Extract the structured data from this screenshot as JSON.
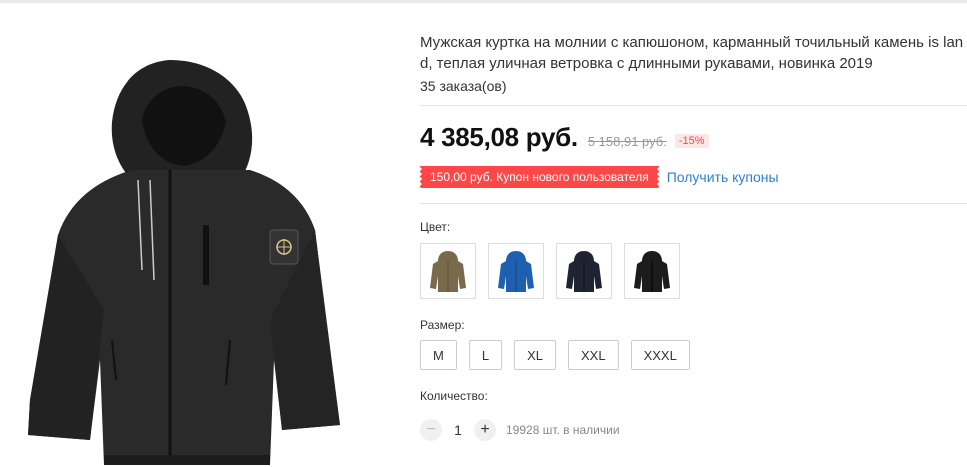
{
  "product": {
    "title": "Мужская куртка на молнии с капюшоном, карманный точильный камень is lan d, теплая уличная ветровка с длинными рукавами, новинка 2019",
    "orders": "35 заказа(ов)",
    "image_icon": "jacket-photo"
  },
  "pricing": {
    "price": "4 385,08 руб.",
    "old_price": "5 158,91 руб.",
    "discount": "-15%"
  },
  "coupon": {
    "text": "150,00 руб. Купон нового пользователя",
    "link": "Получить купоны",
    "color": "#ff4747"
  },
  "color_section": {
    "label": "Цвет:",
    "options": [
      {
        "name": "khaki",
        "color": "#7a6a4c"
      },
      {
        "name": "blue",
        "color": "#1f5fb0"
      },
      {
        "name": "navy",
        "color": "#1f2433"
      },
      {
        "name": "black",
        "color": "#1c1c1c"
      }
    ]
  },
  "size_section": {
    "label": "Размер:",
    "options": [
      "M",
      "L",
      "XL",
      "XXL",
      "XXXL"
    ]
  },
  "quantity_section": {
    "label": "Количество:",
    "minus_icon": "minus-icon",
    "plus_icon": "plus-icon",
    "value": "1",
    "stock": "19928 шт. в наличии"
  }
}
